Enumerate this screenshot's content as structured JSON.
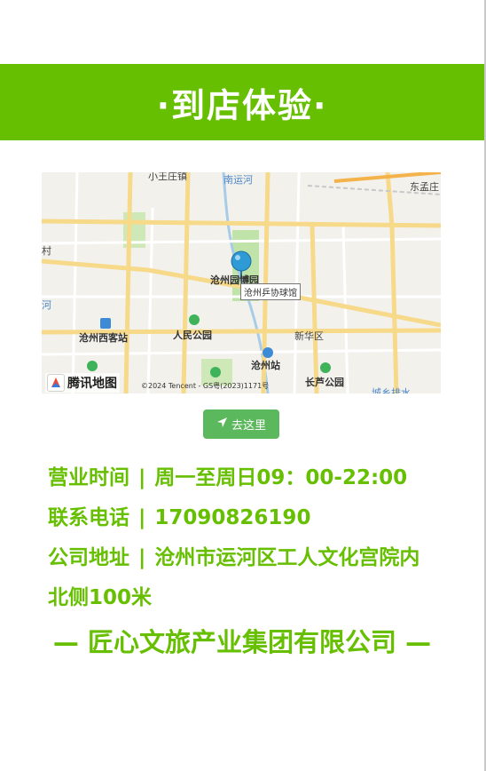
{
  "header": {
    "title": "·到店体验·"
  },
  "map": {
    "labels": {
      "xiaowangzhuang": "小王庄镇",
      "nanyunhe": "南运河",
      "dongmengzhuang": "东孟庄",
      "cun": "村",
      "he": "河",
      "bowuyuan": "沧州园博园",
      "xikezhan": "沧州西客站",
      "renmingongyuan": "人民公园",
      "xinhuaqu": "新华区",
      "cangzhouzhan": "沧州站",
      "changlugongyuan": "长芦公园",
      "partial_right": "城乡排水"
    },
    "callout": "沧州乒协球馆",
    "logo_text": "腾讯地图",
    "copyright": "©2024 Tencent - GS粤(2023)1171号"
  },
  "button": {
    "label": "去这里",
    "icon": "send-icon"
  },
  "info": {
    "hours_label": "营业时间",
    "hours_value": "周一至周日09：00-22:00",
    "phone_label": "联系电话",
    "phone_value": "17090826190",
    "address_label": "公司地址",
    "address_value": "沧州市运河区工人文化宫院内",
    "address_value_2": "北侧100米",
    "separator": "|"
  },
  "company": {
    "name": "— 匠心文旅产业集团有限公司 —"
  },
  "colors": {
    "brand_green": "#66bf00",
    "button_green": "#5cb85c"
  }
}
